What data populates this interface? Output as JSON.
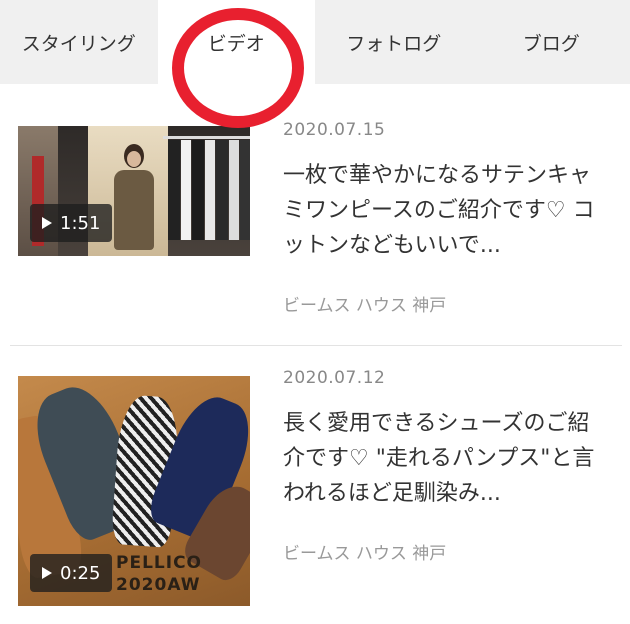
{
  "tabs": [
    {
      "label": "スタイリング"
    },
    {
      "label": "ビデオ"
    },
    {
      "label": "フォトログ"
    },
    {
      "label": "ブログ"
    }
  ],
  "active_tab": "ビデオ",
  "items": [
    {
      "date": "2020.07.15",
      "title": "一枚で華やかになるサテンキャミワンピースのご紹介です♡ コットンなどもいいで...",
      "shop": "ビームス ハウス 神戸",
      "duration": "1:51"
    },
    {
      "date": "2020.07.12",
      "title": "長く愛用できるシューズのご紹介です♡ \"走れるパンプス\"と言われるほど足馴染み...",
      "shop": "ビームス ハウス 神戸",
      "duration": "0:25",
      "thumb_text_1": "PELLICO",
      "thumb_text_2": "2020AW"
    }
  ],
  "colors": {
    "tab_bar_bg": "#f0f0f0",
    "active_tab_bg": "#ffffff",
    "highlight": "#e8202f",
    "date": "#888888",
    "shop": "#999999"
  }
}
